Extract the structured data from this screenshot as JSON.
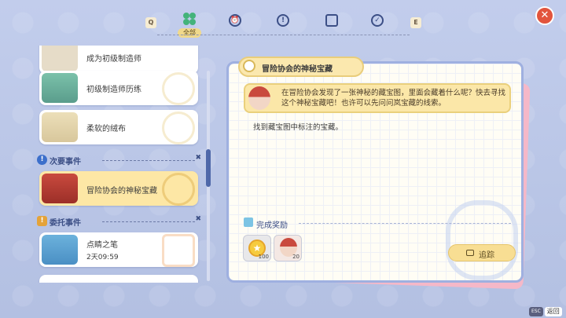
{
  "tabs": {
    "left_key": "Q",
    "right_key": "E",
    "active_label": "全部",
    "icons": [
      "clover-icon",
      "alarm-icon",
      "exclamation-icon",
      "book-icon",
      "check-icon"
    ]
  },
  "list": {
    "items_top": [
      {
        "title": "成为初级制造师",
        "sub": ""
      },
      {
        "title": "初级制造师历练",
        "sub": ""
      },
      {
        "title": "柔软的绒布",
        "sub": ""
      }
    ],
    "sections": {
      "secondary": "次要事件",
      "commission": "委托事件"
    },
    "secondary_items": [
      {
        "title": "冒险协会的神秘宝藏"
      }
    ],
    "commission_items": [
      {
        "title": "点睛之笔",
        "sub": "2天09:59"
      }
    ]
  },
  "detail": {
    "title": "冒险协会的神秘宝藏",
    "dialogue": "在冒险协会发现了一张神秘的藏宝图，里面会藏着什么呢？快去寻找这个神秘宝藏吧！也许可以先问问岚宝藏的线索。",
    "objective": "找到藏宝图中标注的宝藏。",
    "rewards_label": "完成奖励",
    "rewards": [
      {
        "qty": "100"
      },
      {
        "qty": "20"
      }
    ],
    "track_label": "追踪"
  },
  "footer": {
    "esc_key": "ESC",
    "back_label": "返回"
  },
  "colors": {
    "accent": "#fbe7a8",
    "close": "#e2543d",
    "section": "#3c4f86"
  }
}
